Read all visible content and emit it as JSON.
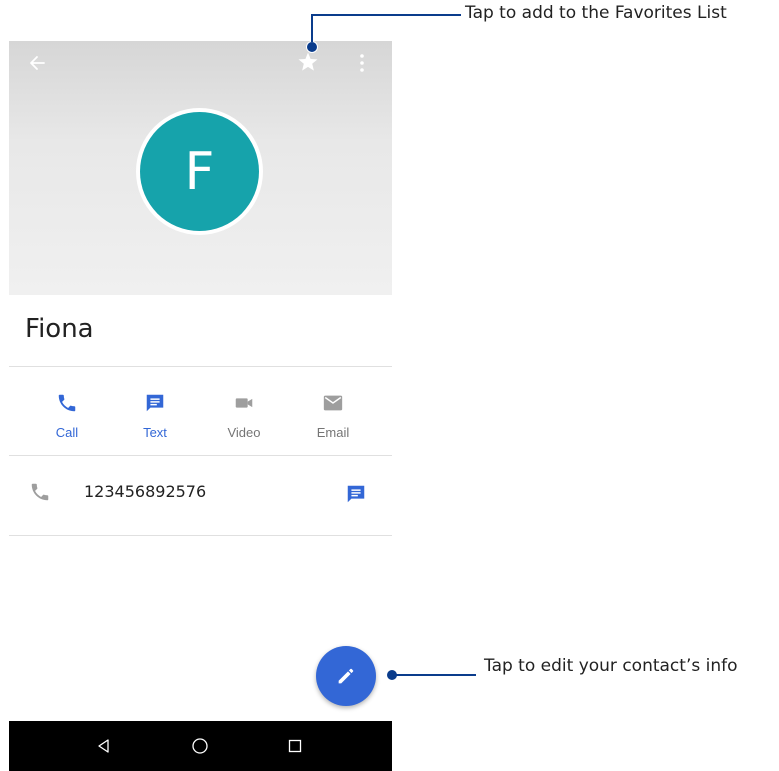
{
  "contact": {
    "initial": "F",
    "name": "Fiona",
    "phone": "123456892576"
  },
  "actions": [
    {
      "label": "Call",
      "icon": "phone-icon",
      "color": "#3367d6"
    },
    {
      "label": "Text",
      "icon": "message-icon",
      "color": "#3367d6"
    },
    {
      "label": "Video",
      "icon": "videocam-icon",
      "color": "#757575"
    },
    {
      "label": "Email",
      "icon": "email-icon",
      "color": "#757575"
    }
  ],
  "icons": {
    "back": "arrow-left-icon",
    "favorite": "star-icon",
    "more": "more-vert-icon",
    "edit": "pencil-icon",
    "nav": [
      "back-triangle-icon",
      "home-circle-icon",
      "recents-square-icon"
    ]
  },
  "colors": {
    "avatar": "#16a3ab",
    "accent": "#3367d6",
    "callout": "#0a3c8c"
  },
  "callouts": {
    "favorites": "Tap to add to the Favorites List",
    "edit": "Tap to edit your contact’s info"
  }
}
